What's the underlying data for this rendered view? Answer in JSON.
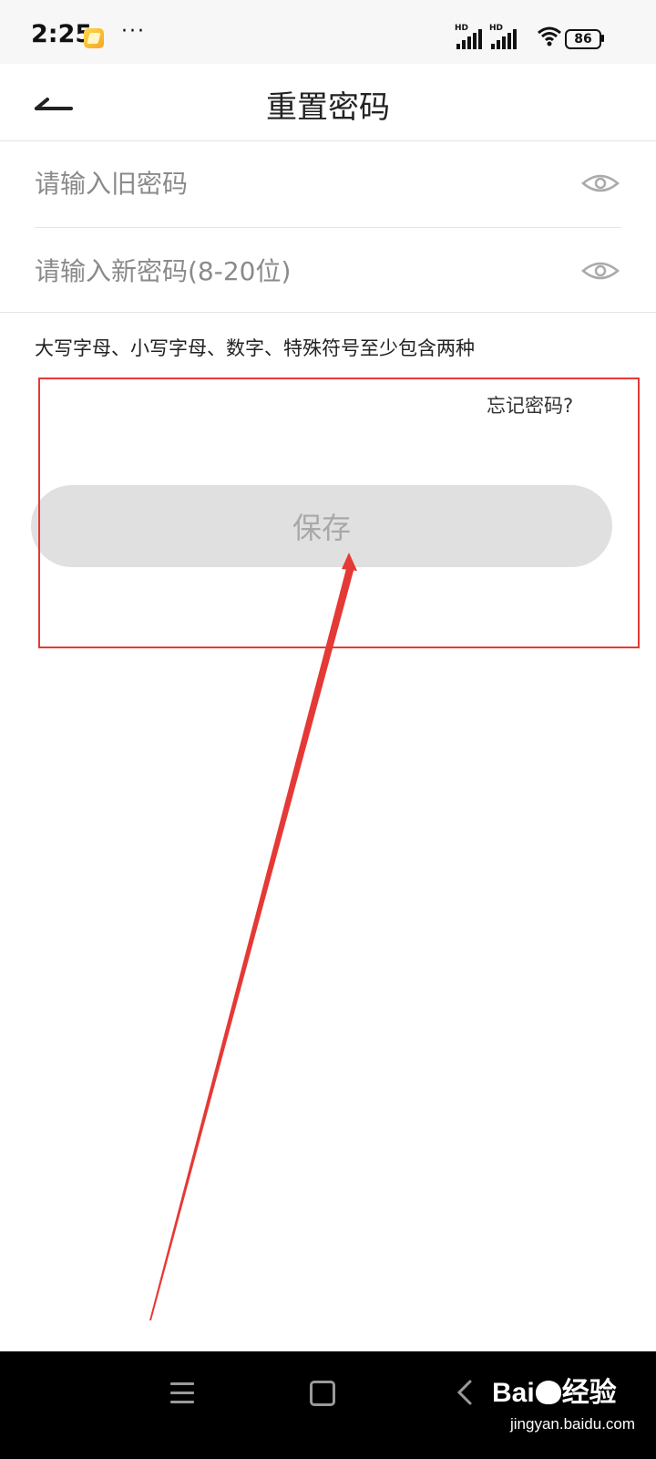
{
  "status_bar": {
    "time": "2:25",
    "more": "···",
    "signal1_label": "HD",
    "signal2_label": "HD",
    "battery": "86"
  },
  "header": {
    "title": "重置密码"
  },
  "form": {
    "old_password_placeholder": "请输入旧密码",
    "new_password_placeholder": "请输入新密码(8-20位)",
    "hint": "大写字母、小写字母、数字、特殊符号至少包含两种",
    "forgot_label": "忘记密码?",
    "save_label": "保存"
  },
  "watermark": {
    "brand_left": "Bai",
    "brand_right": "经验",
    "url": "jingyan.baidu.com"
  },
  "colors": {
    "annotation": "#e53935",
    "save_button_bg": "#e0e0e0",
    "save_button_text": "#a8a8a8"
  }
}
